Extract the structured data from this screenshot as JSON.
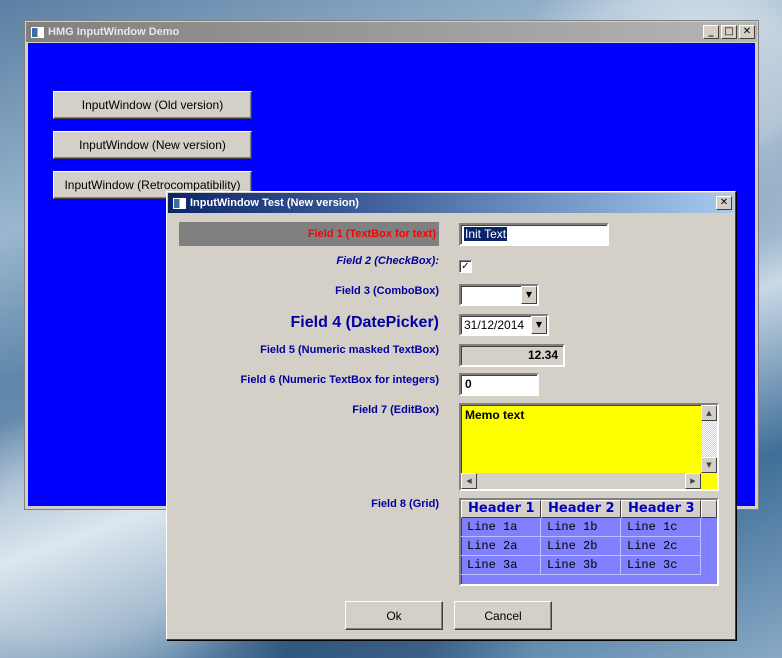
{
  "main_window": {
    "title": "HMG InputWindow Demo",
    "buttons": [
      "InputWindow (Old version)",
      "InputWindow (New version)",
      "InputWindow (Retrocompatibility)"
    ]
  },
  "dialog": {
    "title": "InputWindow Test (New version)",
    "labels": {
      "field1": "Field 1 (TextBox for text)",
      "field2": "Field 2 (CheckBox):",
      "field3": "Field 3 (ComboBox)",
      "field4": "Field 4 (DatePicker)",
      "field5": "Field 5 (Numeric masked TextBox)",
      "field6": "Field 6 (Numeric TextBox for integers)",
      "field7": "Field 7 (EditBox)",
      "field8": "Field 8 (Grid)"
    },
    "field1_value": "Init Text",
    "field2_checked": true,
    "field3_value": "",
    "field4_value": "31/12/2014",
    "field5_value": "12.34",
    "field6_value": "0",
    "field7_value": "Memo text",
    "grid": {
      "headers": [
        "Header 1",
        "Header 2",
        "Header 3"
      ],
      "rows": [
        [
          "Line 1a",
          "Line 1b",
          "Line 1c"
        ],
        [
          "Line 2a",
          "Line 2b",
          "Line 2c"
        ],
        [
          "Line 3a",
          "Line 3b",
          "Line 3c"
        ]
      ]
    },
    "ok_label": "Ok",
    "cancel_label": "Cancel"
  },
  "colors": {
    "client_bg": "#0000ff",
    "label": "#0000a0",
    "field1_label": "#ff0000",
    "editbox_bg": "#ffff00",
    "grid_bg": "#8080ff"
  }
}
